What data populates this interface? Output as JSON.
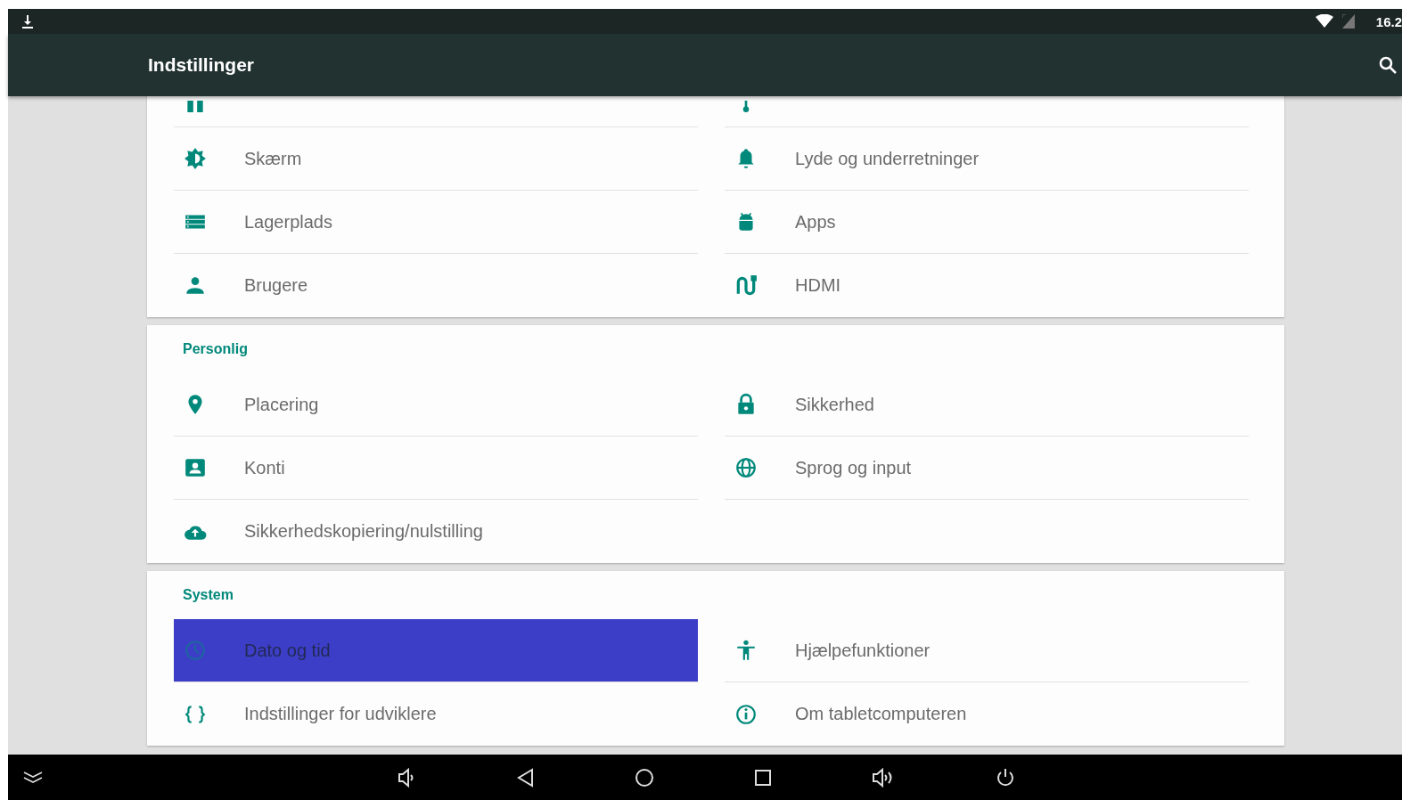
{
  "status_bar": {
    "time": "16.2"
  },
  "app_bar": {
    "title": "Indstillinger"
  },
  "sections": [
    {
      "items": [
        {
          "label": "Skærm",
          "selected": false
        },
        {
          "label": "Lyde og underretninger",
          "selected": false
        },
        {
          "label": "Lagerplads",
          "selected": false
        },
        {
          "label": "Apps",
          "selected": false
        },
        {
          "label": "Brugere",
          "selected": false
        },
        {
          "label": "HDMI",
          "selected": false
        }
      ]
    },
    {
      "header": "Personlig",
      "items": [
        {
          "label": "Placering",
          "selected": false
        },
        {
          "label": "Sikkerhed",
          "selected": false
        },
        {
          "label": "Konti",
          "selected": false
        },
        {
          "label": "Sprog og input",
          "selected": false
        },
        {
          "label": "Sikkerhedskopiering/nulstilling",
          "selected": false
        }
      ]
    },
    {
      "header": "System",
      "items": [
        {
          "label": "Dato og tid",
          "selected": true
        },
        {
          "label": "Hjælpefunktioner",
          "selected": false
        },
        {
          "label": "Indstillinger for udviklere",
          "selected": false
        },
        {
          "label": "Om tabletcomputeren",
          "selected": false
        }
      ]
    }
  ]
}
